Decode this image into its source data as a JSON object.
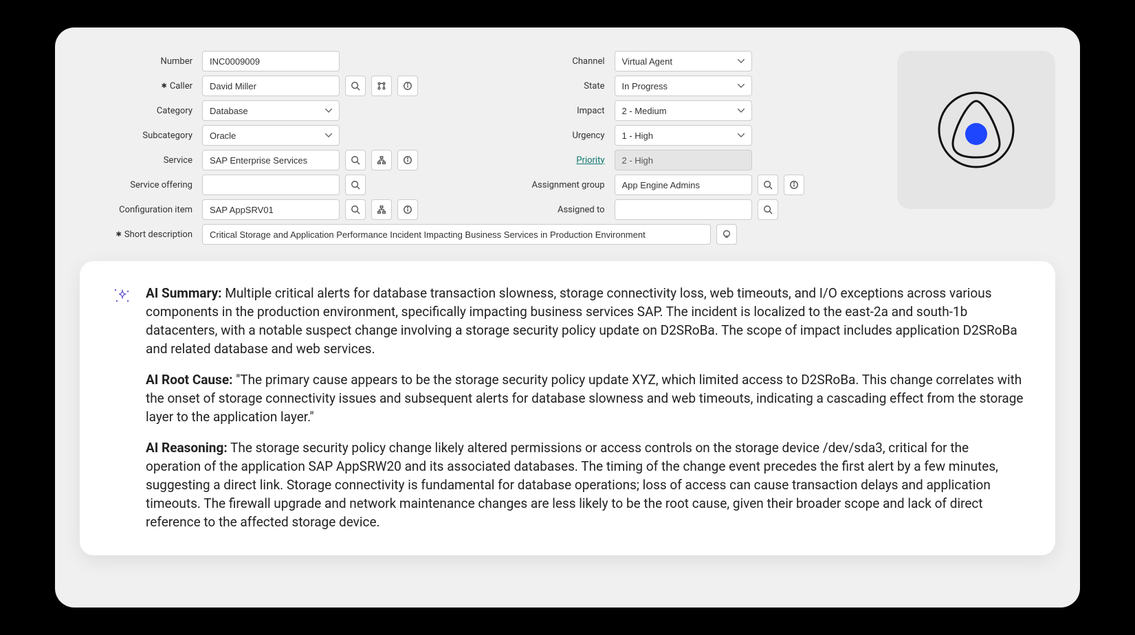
{
  "form": {
    "left": {
      "number_label": "Number",
      "number_value": "INC0009009",
      "caller_label": "Caller",
      "caller_value": "David Miller",
      "category_label": "Category",
      "category_value": "Database",
      "subcategory_label": "Subcategory",
      "subcategory_value": "Oracle",
      "service_label": "Service",
      "service_value": "SAP Enterprise Services",
      "service_offering_label": "Service offering",
      "service_offering_value": "",
      "ci_label": "Configuration item",
      "ci_value": "SAP AppSRV01",
      "short_desc_label": "Short description",
      "short_desc_value": "Critical Storage and Application Performance Incident Impacting Business Services in Production Environment"
    },
    "right": {
      "channel_label": "Channel",
      "channel_value": "Virtual Agent",
      "state_label": "State",
      "state_value": "In Progress",
      "impact_label": "Impact",
      "impact_value": "2 - Medium",
      "urgency_label": "Urgency",
      "urgency_value": "1 - High",
      "priority_label": "Priority",
      "priority_value": "2 - High",
      "assignment_group_label": "Assignment group",
      "assignment_group_value": "App Engine Admins",
      "assigned_to_label": "Assigned to",
      "assigned_to_value": ""
    }
  },
  "ai": {
    "summary_label": "AI Summary:",
    "summary_text": " Multiple critical alerts for database transaction slowness, storage connectivity loss, web timeouts, and I/O exceptions across various components in the production environment, specifically impacting business services SAP. The incident is localized to the east-2a and south-1b datacenters, with a notable suspect change involving a storage security policy update on D2SRoBa. The scope of impact includes application D2SRoBa and related database and web services.",
    "root_cause_label": "AI Root Cause:",
    "root_cause_text": " \"The primary cause appears to be the storage security policy update XYZ, which limited access to D2SRoBa. This change correlates with the onset of storage connectivity issues and subsequent alerts for database slowness and web timeouts, indicating a cascading effect from the storage layer to the application layer.\"",
    "reasoning_label": "AI Reasoning:",
    "reasoning_text": " The storage security policy change likely altered permissions or access controls on the storage device /dev/sda3, critical for the operation of the application SAP AppSRW20 and its associated databases. The timing of the change event precedes the first alert by a few minutes, suggesting a direct link. Storage connectivity is fundamental for database operations; loss of access can cause transaction delays and application timeouts. The firewall upgrade and network maintenance changes are less likely to be the root cause, given their broader scope and lack of direct reference to the affected storage device."
  }
}
